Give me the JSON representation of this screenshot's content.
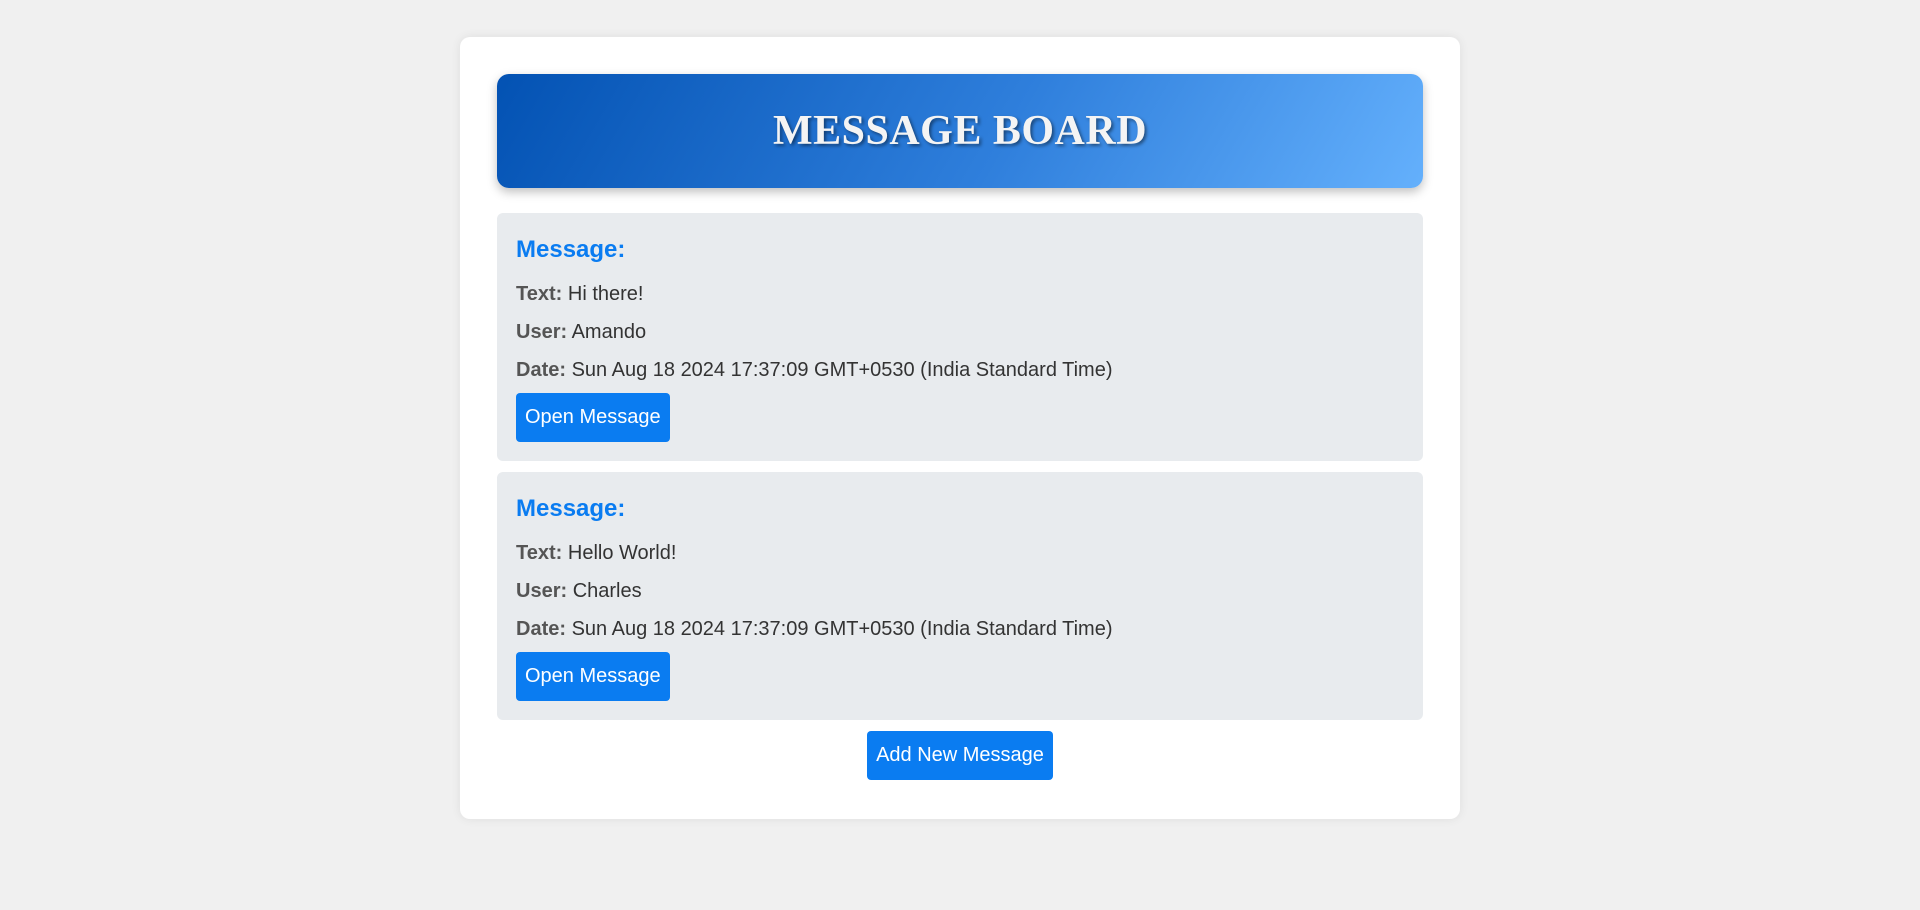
{
  "header": {
    "title": "MESSAGE BOARD"
  },
  "labels": {
    "text": "Text:",
    "user": "User:",
    "date": "Date:"
  },
  "messages": [
    {
      "heading": "Message:",
      "text": "Hi there!",
      "user": "Amando",
      "date": "Sun Aug 18 2024 17:37:09 GMT+0530 (India Standard Time)",
      "button": "Open Message"
    },
    {
      "heading": "Message:",
      "text": "Hello World!",
      "user": "Charles",
      "date": "Sun Aug 18 2024 17:37:09 GMT+0530 (India Standard Time)",
      "button": "Open Message"
    }
  ],
  "add_button": "Add New Message",
  "colors": {
    "page_background": "#f0f0f0",
    "card_background": "#e8ebee",
    "accent": "#0a7cf1",
    "header_gradient_start": "#0352b3",
    "header_gradient_end": "#64b0fc"
  }
}
